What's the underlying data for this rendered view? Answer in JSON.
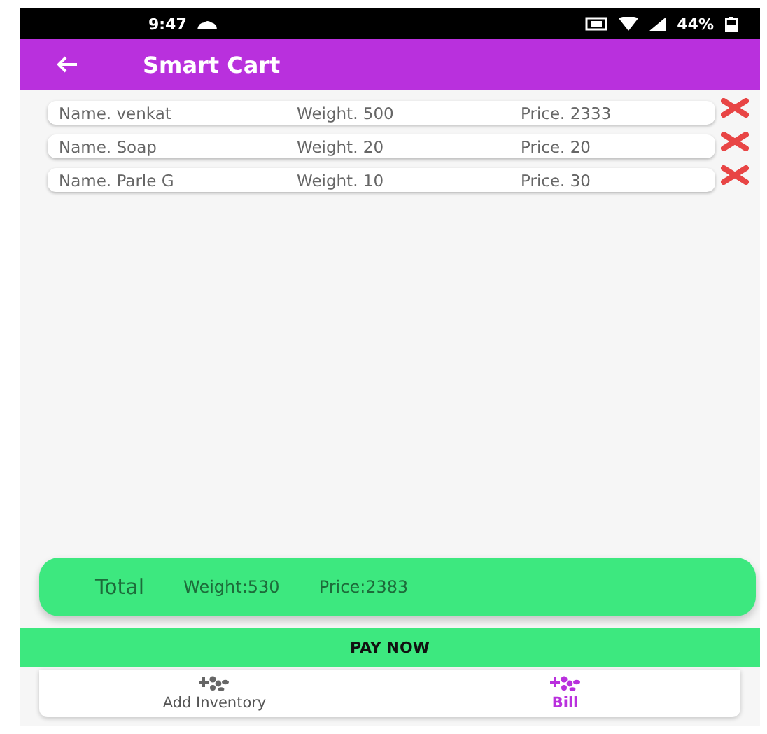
{
  "status_bar": {
    "time": "9:47",
    "battery": "44%"
  },
  "app_bar": {
    "title": "Smart Cart"
  },
  "items": [
    {
      "name": "Name. venkat",
      "weight": "Weight. 500",
      "price": "Price. 2333"
    },
    {
      "name": "Name. Soap",
      "weight": "Weight. 20",
      "price": "Price. 20"
    },
    {
      "name": "Name. Parle G",
      "weight": "Weight. 10",
      "price": "Price. 30"
    }
  ],
  "total": {
    "label": "Total",
    "weight": "Weight:530",
    "price": "Price:2383"
  },
  "pay_button": "PAY NOW",
  "bottom_nav": [
    {
      "label": "Add Inventory",
      "selected": false
    },
    {
      "label": "Bill",
      "selected": true
    }
  ]
}
